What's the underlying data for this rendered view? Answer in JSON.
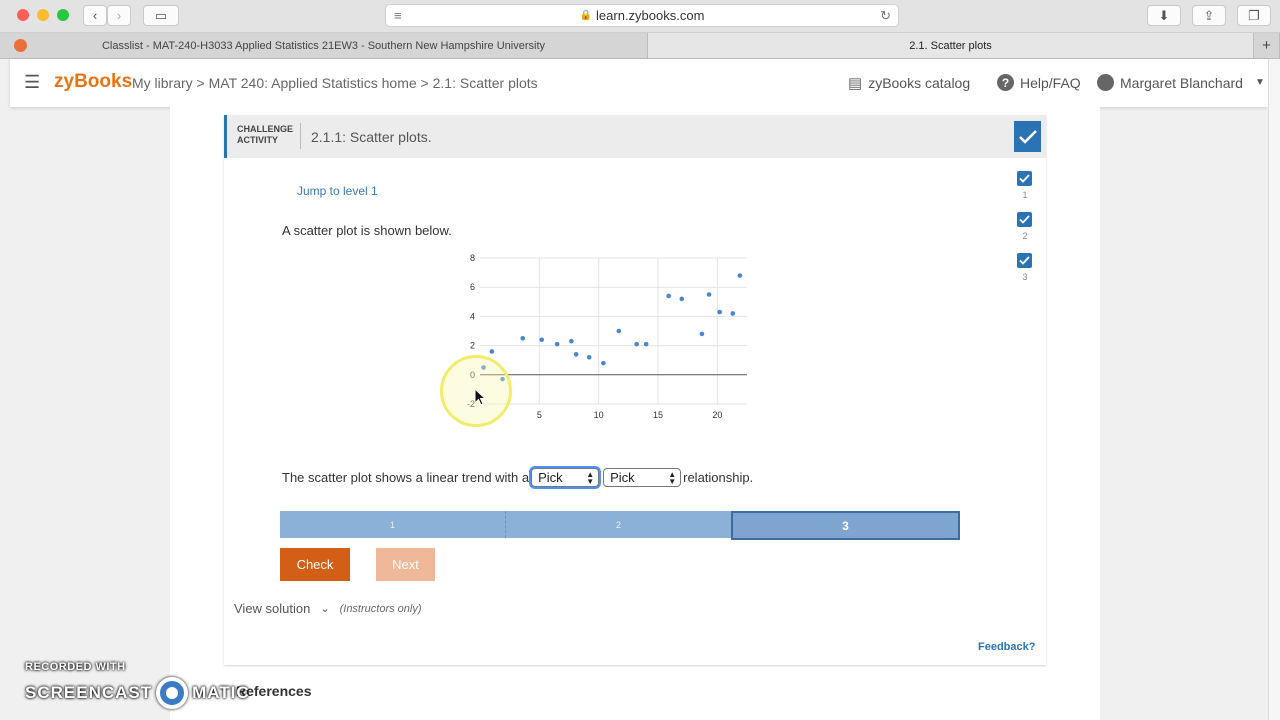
{
  "browser": {
    "url": "learn.zybooks.com",
    "tabs": [
      {
        "label": "Classlist - MAT-240-H3033 Applied Statistics 21EW3 - Southern New Hampshire University",
        "active": false
      },
      {
        "label": "2.1. Scatter plots",
        "active": true
      }
    ]
  },
  "header": {
    "logo": "zyBooks",
    "breadcrumb": "My library > MAT 240: Applied Statistics home > 2.1: Scatter plots",
    "catalog": "zyBooks catalog",
    "help": "Help/FAQ",
    "user": "Margaret Blanchard"
  },
  "activity": {
    "kicker_line1": "CHALLENGE",
    "kicker_line2": "ACTIVITY",
    "title": "2.1.1: Scatter plots.",
    "jump": "Jump to level 1",
    "levels": [
      "1",
      "2",
      "3"
    ],
    "prompt": "A scatter plot is shown below.",
    "sentence_before": "The scatter plot shows a linear trend with a",
    "sentence_after": "relationship.",
    "select1": "Pick",
    "select2": "Pick",
    "progress": [
      "1",
      "2",
      "3"
    ],
    "check": "Check",
    "next": "Next",
    "view_solution": "View solution",
    "instructors_only": "(Instructors only)",
    "feedback": "Feedback?"
  },
  "references": "References",
  "watermark": {
    "line1": "RECORDED WITH",
    "line2a": "SCREENCAST",
    "line2b": "MATIC"
  },
  "colors": {
    "accent": "#2a74b5",
    "brand": "#e87511",
    "check_btn": "#d35f17",
    "next_btn": "#efb898",
    "points": "#4a86d0"
  },
  "chart_data": {
    "type": "scatter",
    "title": "",
    "xlabel": "",
    "ylabel": "",
    "xlim": [
      0,
      22.5
    ],
    "ylim": [
      -2,
      8
    ],
    "xticks": [
      5,
      10,
      15,
      20
    ],
    "yticks": [
      8,
      6,
      4,
      2,
      0,
      -2
    ],
    "grid": true,
    "points": [
      [
        0.3,
        0.5
      ],
      [
        1.0,
        1.6
      ],
      [
        1.9,
        -0.3
      ],
      [
        3.6,
        2.5
      ],
      [
        5.2,
        2.4
      ],
      [
        6.5,
        2.1
      ],
      [
        7.7,
        2.3
      ],
      [
        8.1,
        1.4
      ],
      [
        9.2,
        1.2
      ],
      [
        10.4,
        0.8
      ],
      [
        11.7,
        3.0
      ],
      [
        13.2,
        2.1
      ],
      [
        14.0,
        2.1
      ],
      [
        15.9,
        5.4
      ],
      [
        17.0,
        5.2
      ],
      [
        18.7,
        2.8
      ],
      [
        19.3,
        5.5
      ],
      [
        20.2,
        4.3
      ],
      [
        21.3,
        4.2
      ],
      [
        21.9,
        6.8
      ]
    ]
  }
}
